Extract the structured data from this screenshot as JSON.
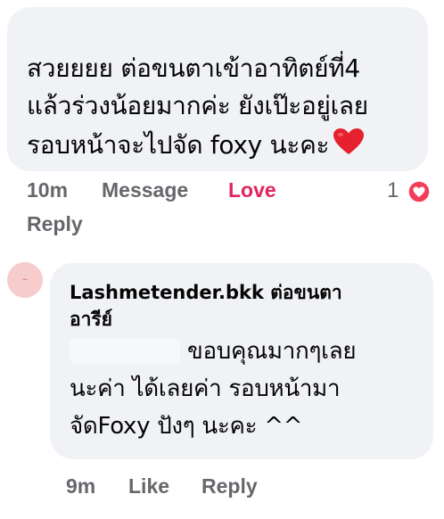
{
  "comment1": {
    "lines": [
      "สวยยยย ต่อขนตาเข้าอาทิตย์ที่4",
      "แล้วร่วงน้อยมากค่ะ ยังเป๊ะอยู่เลย",
      "รอบหน้าจะไปจัด foxy นะคะ"
    ],
    "emoji": "heart-emoji",
    "time": "10m",
    "message_label": "Message",
    "love_label": "Love",
    "reaction_count": "1",
    "reply_label": "Reply",
    "love_color": "#e0245e"
  },
  "comment2": {
    "author": "Lashmetender.bkk",
    "author_suffix": "ต่อขนตา",
    "author_line2": "อารีย์",
    "lines": [
      "ขอบคุณมากๆเลย",
      "นะค่า ได้เลยค่า รอบหน้ามา",
      "จัดFoxy ปังๆ นะคะ ^^"
    ],
    "time": "9m",
    "like_label": "Like",
    "reply_label": "Reply"
  },
  "colors": {
    "bubble": "#f0f2f5",
    "meta_text": "#65676b",
    "reaction_heart": "#f33e58"
  }
}
